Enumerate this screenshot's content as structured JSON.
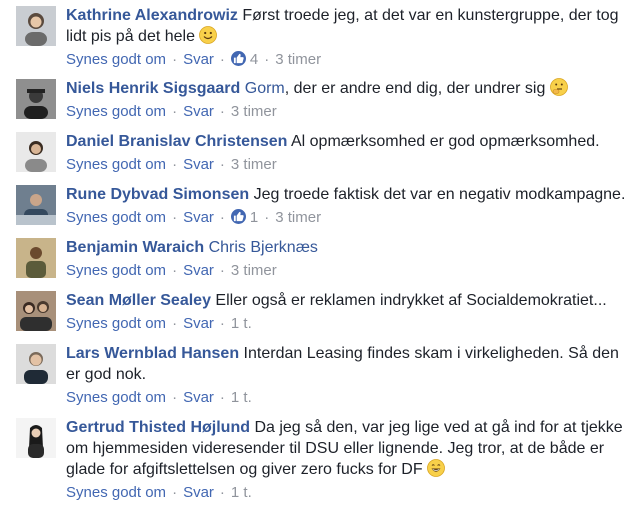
{
  "actions": {
    "like": "Synes godt om",
    "reply": "Svar",
    "separator": "·"
  },
  "comments": [
    {
      "author": "Kathrine Alexandrowiz",
      "text": "Først troede jeg, at det var en kunstergruppe, der tog lidt pis på det hele",
      "emoji": "smile-emoji",
      "likes": "4",
      "time": "3 timer"
    },
    {
      "author": "Niels Henrik Sigsgaard",
      "mention": "Gorm",
      "text": ", der er andre end dig, der undrer sig",
      "emoji": "thinking-emoji",
      "time": "3 timer"
    },
    {
      "author": "Daniel Branislav Christensen",
      "text": "Al opmærksomhed er god opmærksomhed.",
      "time": "3 timer"
    },
    {
      "author": "Rune Dybvad Simonsen",
      "text": "Jeg troede faktisk det var en negativ modkampagne.",
      "likes": "1",
      "time": "3 timer"
    },
    {
      "author": "Benjamin Waraich",
      "mention": "Chris Bjerknæs",
      "time": "3 timer"
    },
    {
      "author": "Sean Møller Sealey",
      "text": "Eller også er reklamen indrykket af Socialdemokratiet...",
      "time": "1 t."
    },
    {
      "author": "Lars Wernblad Hansen",
      "text": "Interdan Leasing findes skam i virkeligheden. Så den er god nok.",
      "time": "1 t."
    },
    {
      "author": "Gertrud Thisted Højlund",
      "text": "Da jeg så den, var jeg lige ved at gå ind for at tjekke om hjemmesiden videresender til DSU eller lignende. Jeg tror, at de både er glade for afgiftslettelsen og giver zero fucks for DF",
      "emoji": "grin-emoji",
      "time": "1 t."
    }
  ],
  "colors": {
    "link": "#365899",
    "action": "#4267b2",
    "meta": "#90949c",
    "text": "#1d2129"
  }
}
